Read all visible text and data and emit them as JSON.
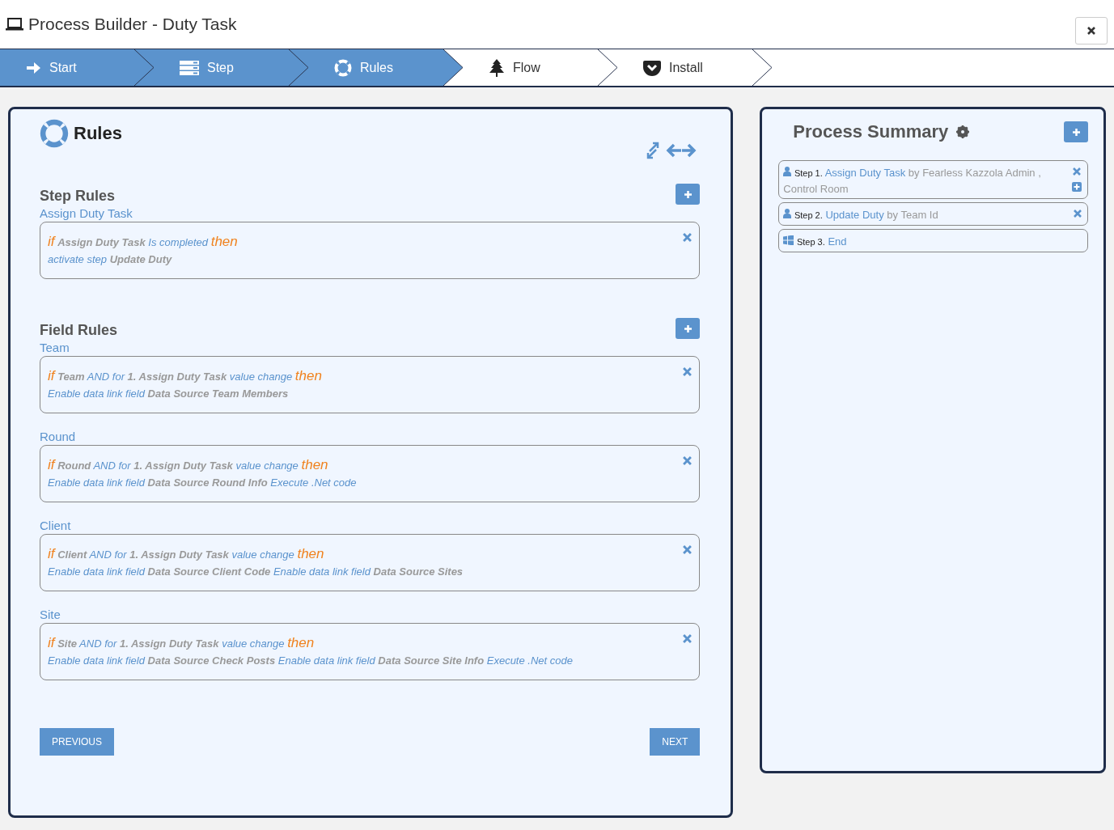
{
  "window": {
    "title": "Process Builder - Duty Task"
  },
  "wizard": [
    {
      "label": "Start",
      "active": true
    },
    {
      "label": "Step",
      "active": true
    },
    {
      "label": "Rules",
      "active": true
    },
    {
      "label": "Flow",
      "active": false
    },
    {
      "label": "Install",
      "active": false
    }
  ],
  "rules_panel": {
    "title": "Rules",
    "sections": [
      {
        "title": "Step Rules",
        "groups": [
          {
            "label": "Assign Duty Task",
            "lines": [
              [
                {
                  "kind": "keyword",
                  "text": "if"
                },
                {
                  "kind": "ref",
                  "text": "Assign Duty Task"
                },
                {
                  "kind": "text",
                  "text": "Is completed"
                },
                {
                  "kind": "keyword",
                  "text": "then"
                }
              ],
              [
                {
                  "kind": "text",
                  "text": "activate step"
                },
                {
                  "kind": "ref",
                  "text": "Update Duty"
                }
              ]
            ]
          }
        ]
      },
      {
        "title": "Field Rules",
        "groups": [
          {
            "label": "Team",
            "lines": [
              [
                {
                  "kind": "keyword",
                  "text": "if"
                },
                {
                  "kind": "ref",
                  "text": "Team"
                },
                {
                  "kind": "text",
                  "text": "AND for"
                },
                {
                  "kind": "ref",
                  "text": "1. Assign Duty Task"
                },
                {
                  "kind": "text",
                  "text": "value change"
                },
                {
                  "kind": "keyword",
                  "text": "then"
                }
              ],
              [
                {
                  "kind": "text",
                  "text": "Enable data link field"
                },
                {
                  "kind": "ref",
                  "text": "Data Source Team Members"
                }
              ]
            ]
          },
          {
            "label": "Round",
            "lines": [
              [
                {
                  "kind": "keyword",
                  "text": "if"
                },
                {
                  "kind": "ref",
                  "text": "Round"
                },
                {
                  "kind": "text",
                  "text": "AND for"
                },
                {
                  "kind": "ref",
                  "text": "1. Assign Duty Task"
                },
                {
                  "kind": "text",
                  "text": "value change"
                },
                {
                  "kind": "keyword",
                  "text": "then"
                }
              ],
              [
                {
                  "kind": "text",
                  "text": "Enable data link field"
                },
                {
                  "kind": "ref",
                  "text": "Data Source Round Info"
                },
                {
                  "kind": "text",
                  "text": "Execute .Net code"
                }
              ]
            ]
          },
          {
            "label": "Client",
            "lines": [
              [
                {
                  "kind": "keyword",
                  "text": "if"
                },
                {
                  "kind": "ref",
                  "text": "Client"
                },
                {
                  "kind": "text",
                  "text": "AND for"
                },
                {
                  "kind": "ref",
                  "text": "1. Assign Duty Task"
                },
                {
                  "kind": "text",
                  "text": "value change"
                },
                {
                  "kind": "keyword",
                  "text": "then"
                }
              ],
              [
                {
                  "kind": "text",
                  "text": "Enable data link field"
                },
                {
                  "kind": "ref",
                  "text": "Data Source Client Code"
                },
                {
                  "kind": "text",
                  "text": "Enable data link field"
                },
                {
                  "kind": "ref",
                  "text": "Data Source Sites"
                }
              ]
            ]
          },
          {
            "label": "Site",
            "lines": [
              [
                {
                  "kind": "keyword",
                  "text": "if"
                },
                {
                  "kind": "ref",
                  "text": "Site"
                },
                {
                  "kind": "text",
                  "text": "AND for"
                },
                {
                  "kind": "ref",
                  "text": "1. Assign Duty Task"
                },
                {
                  "kind": "text",
                  "text": "value change"
                },
                {
                  "kind": "keyword",
                  "text": "then"
                }
              ],
              [
                {
                  "kind": "text",
                  "text": "Enable data link field"
                },
                {
                  "kind": "ref",
                  "text": "Data Source Check Posts"
                },
                {
                  "kind": "text",
                  "text": "Enable data link field"
                },
                {
                  "kind": "ref",
                  "text": "Data Source Site Info"
                },
                {
                  "kind": "text",
                  "text": "Execute .Net code"
                }
              ]
            ]
          }
        ]
      }
    ],
    "buttons": {
      "previous": "PREVIOUS",
      "next": "NEXT"
    }
  },
  "summary": {
    "title": "Process Summary",
    "steps": [
      {
        "kind": "user",
        "prefix": "Step 1.",
        "name": "Assign Duty Task",
        "by": "by Fearless Kazzola Admin , Control Room",
        "removable": true,
        "addable": true
      },
      {
        "kind": "user",
        "prefix": "Step 2.",
        "name": "Update Duty",
        "by": "by Team Id",
        "removable": true,
        "addable": false
      },
      {
        "kind": "end",
        "prefix": "Step 3.",
        "name": "End",
        "removable": false,
        "addable": false
      }
    ]
  }
}
